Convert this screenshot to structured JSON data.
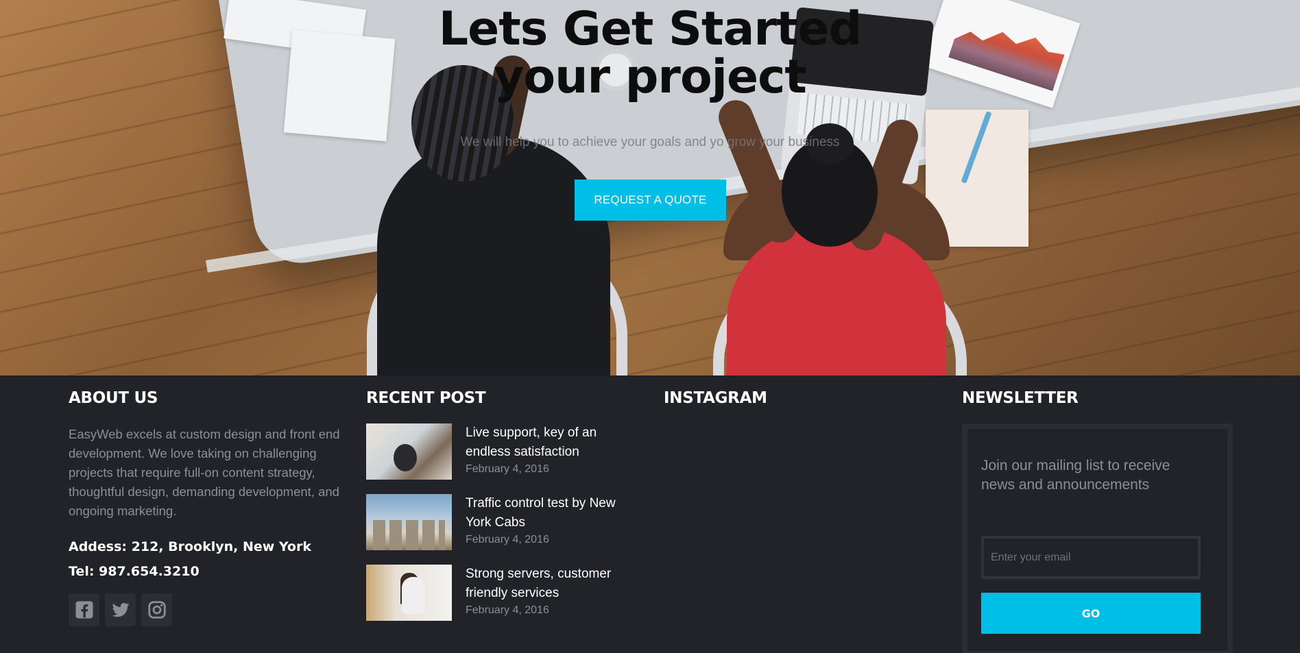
{
  "hero": {
    "title_line1": "Lets Get Started",
    "title_line2": "your project",
    "subtitle": "We will help you to achieve your goals and yo grow your business",
    "cta_label": "REQUEST A QUOTE",
    "accent_color": "#00bfe6"
  },
  "footer": {
    "about": {
      "heading": "ABOUT US",
      "text": "EasyWeb excels at custom design and front end development. We love taking on challenging projects that require full-on content strategy, thoughtful design, demanding development, and ongoing marketing.",
      "address": "Addess: 212, Brooklyn, New York",
      "tel": "Tel: 987.654.3210",
      "socials": [
        "facebook-icon",
        "twitter-icon",
        "instagram-icon"
      ]
    },
    "recent": {
      "heading": "RECENT POST",
      "posts": [
        {
          "title": "Live support, key of an endless satisfaction",
          "date": "February 4, 2016"
        },
        {
          "title": "Traffic control test by New York Cabs",
          "date": "February 4, 2016"
        },
        {
          "title": "Strong servers, customer friendly services",
          "date": "February 4, 2016"
        }
      ]
    },
    "instagram": {
      "heading": "INSTAGRAM"
    },
    "newsletter": {
      "heading": "NEWSLETTER",
      "text": "Join our mailing list to receive news and announcements",
      "email_placeholder": "Enter your email",
      "button_label": "GO"
    },
    "background_color": "#222328"
  }
}
